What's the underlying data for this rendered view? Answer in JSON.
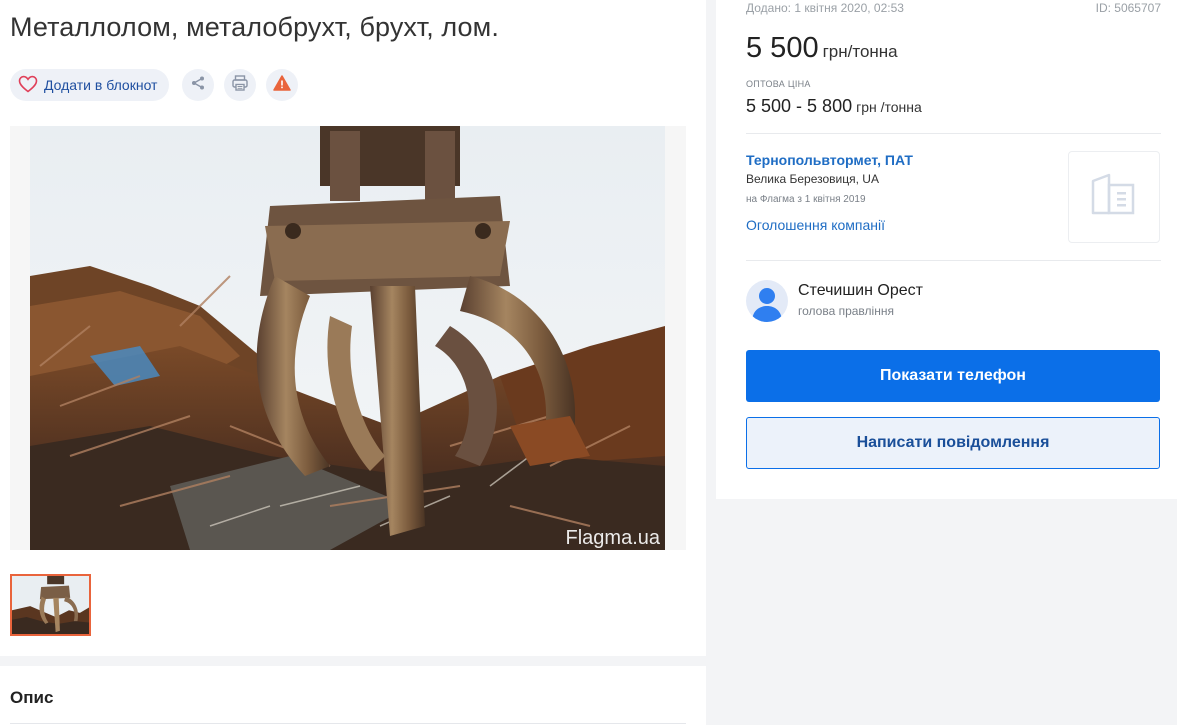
{
  "listing": {
    "title": "Металлолом, металобрухт, брухт, лом.",
    "notepad_label": "Додати в блокнот",
    "actions": {
      "share_icon": "share-icon",
      "print_icon": "printer-icon",
      "report_icon": "warning-icon"
    },
    "photo": {
      "watermark": "Flagma.ua",
      "description": "scrap metal grab claw"
    }
  },
  "description": {
    "title": "Опис"
  },
  "sidebar": {
    "date": "Додано: 1 квітня 2020, 02:53",
    "id": "ID: 5065707",
    "price": {
      "value": "5 500",
      "unit": "грн/тонна"
    },
    "wholesale": {
      "label": "оптова ціна",
      "value": "5 500 - 5 800",
      "unit": "грн /тонна"
    },
    "company": {
      "name": "Тернопольвтормет, ПАТ",
      "location": "Велика Березовиця, UA",
      "since": "на Флагма з 1 квітня 2019",
      "ads_link": "Оголошення компанії"
    },
    "contact": {
      "name": "Стечишин Орест",
      "role": "голова правління"
    },
    "buttons": {
      "phone": "Показати телефон",
      "message": "Написати повідомлення"
    }
  },
  "colors": {
    "accent_blue": "#0b6fe8",
    "link_blue": "#1f6dc4",
    "thumb_border": "#e9643c",
    "warning": "#e9643c"
  }
}
